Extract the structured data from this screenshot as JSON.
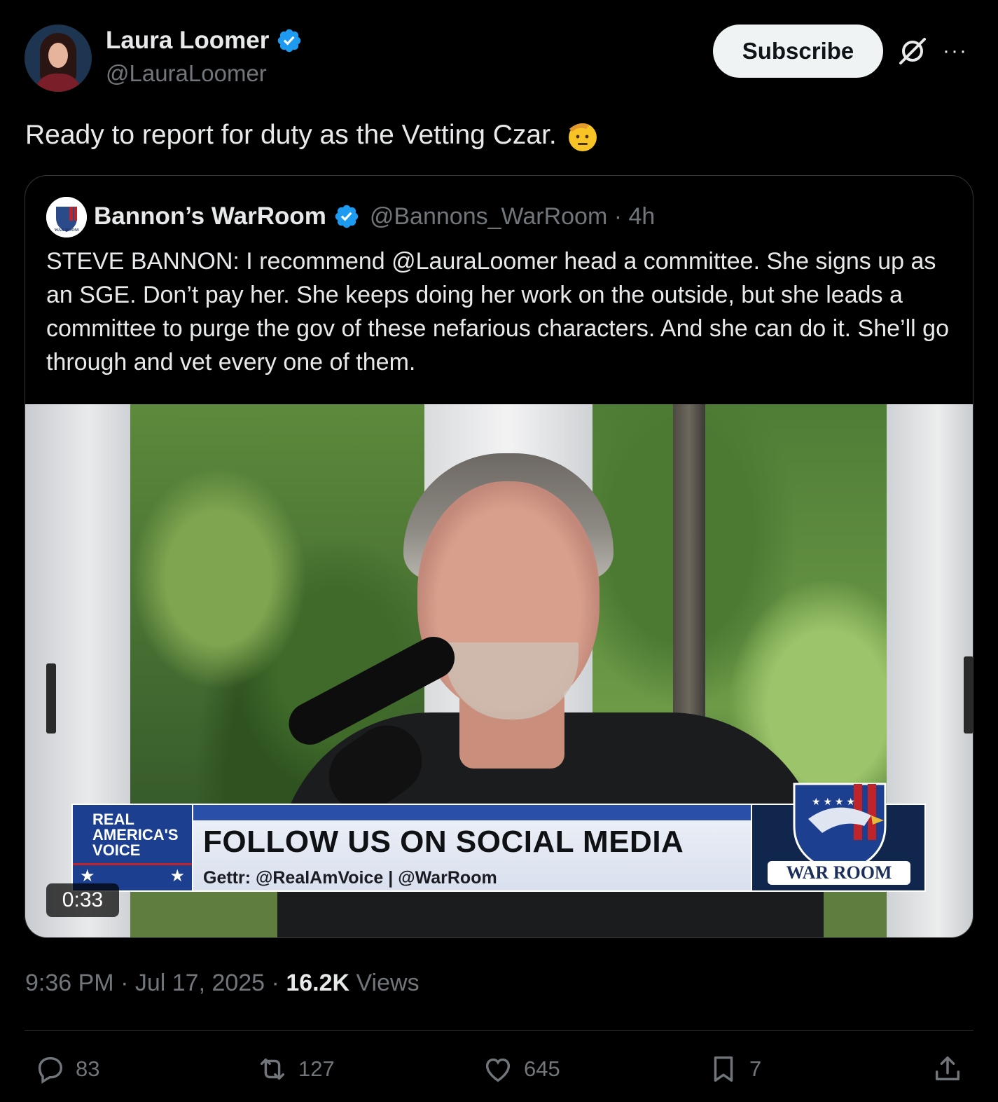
{
  "author": {
    "name": "Laura Loomer",
    "handle": "@LauraLoomer"
  },
  "header": {
    "subscribe_label": "Subscribe",
    "more_label": "···"
  },
  "post": {
    "text": "Ready to report for duty as the Vetting Czar."
  },
  "quoted": {
    "name": "Bannon’s WarRoom",
    "handle": "@Bannons_WarRoom · 4h",
    "avatar_text": "WAR ROOM",
    "text": "STEVE BANNON: I recommend @LauraLoomer head a committee. She signs up as an SGE. Don’t pay her. She keeps doing her work on the outside, but she leads a committee to purge the gov of these nefarious characters. And she can do it. She’ll go through and vet every one of them."
  },
  "video": {
    "duration": "0:33",
    "lower_third": {
      "logo_text": "REAL AMERICA'S VOICE",
      "headline": "FOLLOW US ON SOCIAL MEDIA",
      "subline": "Gettr: @RealAmVoice | @WarRoom",
      "brand": "WAR ROOM"
    }
  },
  "meta": {
    "time": "9:36 PM · Jul 17, 2025 · ",
    "views_count": "16.2K",
    "views_label": " Views"
  },
  "actions": {
    "replies": "83",
    "reposts": "127",
    "likes": "645",
    "bookmarks": "7"
  },
  "colors": {
    "background": "#000000",
    "text": "#e7e9ea",
    "muted": "#71767b",
    "verified": "#1d9bf0",
    "divider": "#2f3336"
  },
  "icons": [
    "verified-badge-icon",
    "salute-emoji-icon",
    "grok-icon",
    "more-icon",
    "reply-icon",
    "repost-icon",
    "like-icon",
    "bookmark-icon",
    "share-icon"
  ]
}
